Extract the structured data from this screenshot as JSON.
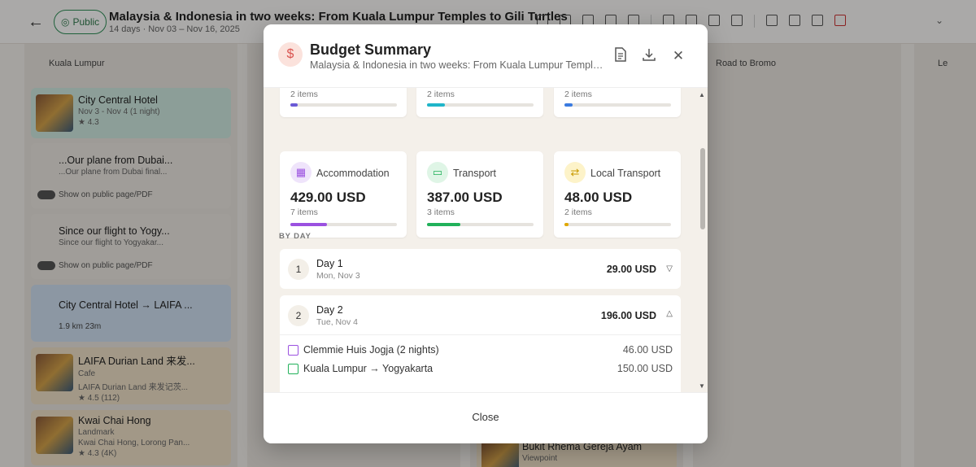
{
  "header": {
    "badge_label": "Public",
    "title": "Malaysia & Indonesia in two weeks: From Kuala Lumpur Temples to Gili Turtles",
    "dates": "14 days · Nov 03 – Nov 16, 2025"
  },
  "board": {
    "columns": [
      {
        "label": "Kuala Lumpur"
      },
      {
        "label": "Road to Bromo"
      },
      {
        "label": "Le"
      }
    ],
    "cards": [
      {
        "title": "City Central Hotel",
        "sub": "Nov 3 - Nov 4 (1 night)",
        "rating": "4.3"
      },
      {
        "title": "...Our plane from Dubai...",
        "sub": "...Our plane from Dubai final...",
        "toggle_label": "Show on public page/PDF"
      },
      {
        "title": "Since our flight to Yogy...",
        "sub": "Since our flight to Yogyakar...",
        "toggle_label": "Show on public page/PDF"
      },
      {
        "title": "City Central Hotel → LAIFA ...",
        "distance": "1.9 km",
        "duration": "23m"
      },
      {
        "title": "LAIFA Durian Land 来发...",
        "category": "Cafe",
        "sub": "LAIFA Durian Land 来发记茨...",
        "rating": "4.5",
        "reviews": "(112)"
      },
      {
        "title": "Kwai Chai Hong",
        "category": "Landmark",
        "sub": "Kwai Chai Hong, Lorong Pan...",
        "rating": "4.3",
        "reviews": "(4K)"
      },
      {
        "title": "Bukit Rhema Gereja Ayam",
        "category": "Viewpoint"
      }
    ]
  },
  "modal": {
    "title": "Budget Summary",
    "subtitle": "Malaysia & Indonesia in two weeks: From Kuala Lumpur Temples to Gili Turtles",
    "top_items": [
      "2 items",
      "2 items",
      "2 items"
    ],
    "categories": [
      {
        "name": "Accommodation",
        "amount": "429.00 USD",
        "count": "7 items",
        "icon": "building-icon",
        "color": "#9b51e0",
        "bg": "#efe4fb",
        "fill": 0.34
      },
      {
        "name": "Transport",
        "amount": "387.00 USD",
        "count": "3 items",
        "icon": "ticket-icon",
        "color": "#21b15a",
        "bg": "#dff5e6",
        "fill": 0.31
      },
      {
        "name": "Local Transport",
        "amount": "48.00 USD",
        "count": "2 items",
        "icon": "route-icon",
        "color": "#e0a800",
        "bg": "#fdf3c9",
        "fill": 0.04
      }
    ],
    "top_bar_fills": [
      {
        "color": "#6a5ad6",
        "fill": 0.07
      },
      {
        "color": "#1fb5c9",
        "fill": 0.17
      },
      {
        "color": "#3a7be0",
        "fill": 0.08
      }
    ],
    "by_day_label": "BY DAY",
    "days": [
      {
        "num": "1",
        "name": "Day 1",
        "date": "Mon, Nov 3",
        "total": "29.00 USD"
      },
      {
        "num": "2",
        "name": "Day 2",
        "date": "Tue, Nov 4",
        "total": "196.00 USD",
        "items": [
          {
            "name": "Clemmie Huis Jogja (2 nights)",
            "amount": "46.00 USD",
            "icon": "building-icon"
          },
          {
            "name": "Kuala Lumpur → Yogyakarta",
            "amount": "150.00 USD",
            "icon": "ticket-icon"
          }
        ]
      }
    ],
    "close_label": "Close"
  }
}
